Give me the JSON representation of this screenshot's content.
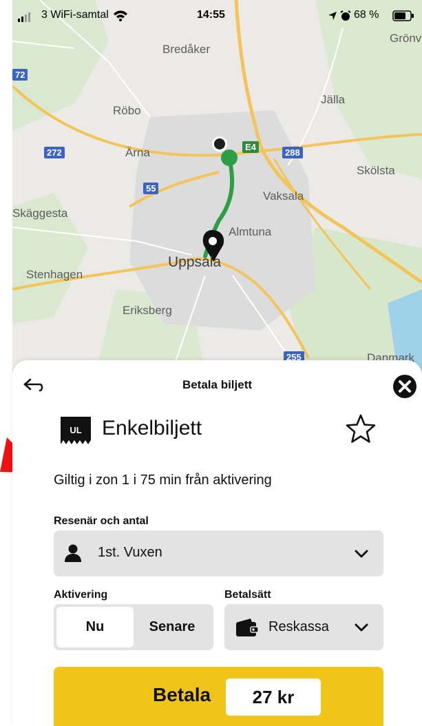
{
  "status_bar": {
    "carrier": "3 WiFi-samtal",
    "time": "14:55",
    "battery": "68 %"
  },
  "map": {
    "places": {
      "bredaker": "Bredåker",
      "gronv": "Grönv",
      "jalla": "Jälla",
      "robo": "Röbo",
      "arna": "Ärna",
      "skolsta": "Skölsta",
      "vaksala": "Vaksala",
      "skaggesta": "Skäggesta",
      "almtuna": "Almtuna",
      "uppsala": "Uppsala",
      "stenhagen": "Stenhagen",
      "eriksberg": "Eriksberg",
      "danmark": "Danmark"
    },
    "shields": {
      "r72": "72",
      "r272": "272",
      "r288": "288",
      "r55": "55",
      "e4": "E4",
      "r255": "255"
    },
    "colors": {
      "route": "#2e9e44",
      "roads": "#f3c559",
      "water": "#9fd1e8"
    }
  },
  "sheet": {
    "title": "Betala biljett",
    "ticket_name": "Enkelbiljett",
    "ticket_icon_text": "UL",
    "validity": "Giltig i zon 1 i 75 min från aktivering",
    "traveller_label": "Resenär och antal",
    "traveller_value": "1st. Vuxen",
    "activation_label": "Aktivering",
    "activation_options": [
      "Nu",
      "Senare"
    ],
    "activation_selected": "Nu",
    "payment_label": "Betalsätt",
    "payment_value": "Reskassa",
    "pay_label": "Betala",
    "price": "27 kr"
  },
  "icons": {
    "back": "back-arrow-icon",
    "close": "close-icon",
    "star": "star-icon",
    "person": "person-icon",
    "wallet": "wallet-icon",
    "chevron": "chevron-down-icon"
  },
  "accent_color": "#f0c419"
}
